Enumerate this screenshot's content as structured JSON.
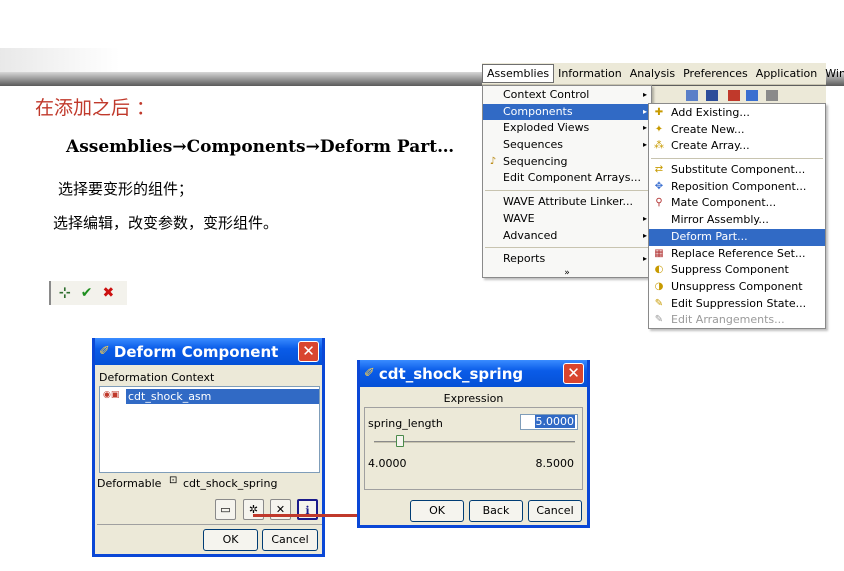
{
  "slide": {
    "heading": "在添加之后 ：",
    "menu_path": "Assemblies→Components→Deform Part…",
    "line1": "选择要变形的组件；",
    "line2": "选择编辑，改变参数，变形组件。"
  },
  "mini_toolbar": {
    "placement_icon": "⊹",
    "ok_icon": "✔",
    "cancel_icon": "✖"
  },
  "menubar": {
    "items": [
      "Assemblies",
      "Information",
      "Analysis",
      "Preferences",
      "Application",
      "Win"
    ]
  },
  "assemblies_menu": {
    "items": [
      {
        "label": "Context Control",
        "arrow": "▸"
      },
      {
        "label": "Components",
        "arrow": "▸"
      },
      {
        "label": "Exploded Views",
        "arrow": "▸"
      },
      {
        "label": "Sequences",
        "arrow": "▸"
      },
      {
        "label": "Sequencing"
      },
      {
        "label": "Edit Component Arrays..."
      },
      {
        "label": "WAVE Attribute Linker..."
      },
      {
        "label": "WAVE",
        "arrow": "▸"
      },
      {
        "label": "Advanced",
        "arrow": "▸"
      },
      {
        "label": "Reports",
        "arrow": "▸"
      }
    ],
    "more_chevron": "»"
  },
  "components_menu": {
    "items": [
      {
        "label": "Add Existing..."
      },
      {
        "label": "Create New..."
      },
      {
        "label": "Create Array..."
      },
      {
        "label": "Substitute Component..."
      },
      {
        "label": "Reposition Component..."
      },
      {
        "label": "Mate Component..."
      },
      {
        "label": "Mirror Assembly..."
      },
      {
        "label": "Deform Part..."
      },
      {
        "label": "Replace Reference Set..."
      },
      {
        "label": "Suppress Component"
      },
      {
        "label": "Unsuppress Component"
      },
      {
        "label": "Edit Suppression State..."
      },
      {
        "label": "Edit Arrangements..."
      }
    ]
  },
  "deform_dialog": {
    "title": "Deform Component",
    "context_label": "Deformation Context",
    "tree_item": "cdt_shock_asm",
    "deformable_label": "Deformable",
    "deformable_value": "cdt_shock_spring",
    "ok": "OK",
    "cancel": "Cancel",
    "close_glyph": "✕"
  },
  "expression_dialog": {
    "title": "cdt_shock_spring",
    "section_label": "Expression",
    "param_name": "spring_length",
    "param_value": "5.0000",
    "min_label": "4.0000",
    "max_label": "8.5000",
    "slider_level": 0.13,
    "ok": "OK",
    "back": "Back",
    "cancel": "Cancel",
    "close_glyph": "✕"
  },
  "colors": {
    "heading_red": "#c0392b",
    "xp_title_blue": "#0a5ce8",
    "menu_highlight": "#316ac5",
    "dialog_face": "#ece9d8"
  }
}
